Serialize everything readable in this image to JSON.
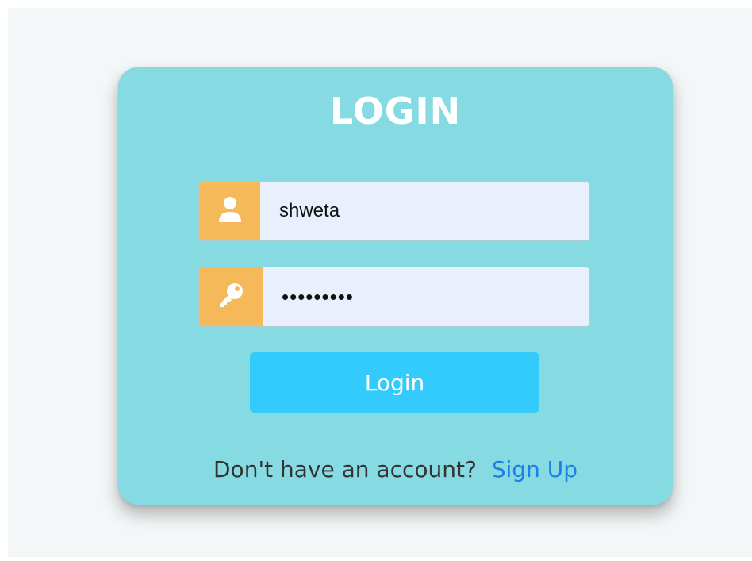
{
  "login_card": {
    "title": "LOGIN",
    "username_field": {
      "value": "shweta",
      "icon": "user-icon"
    },
    "password_field": {
      "value": "•••••••••",
      "icon": "key-icon"
    },
    "login_button_label": "Login",
    "footer": {
      "prompt": "Don't have an account?",
      "signup_link": "Sign Up"
    }
  },
  "colors": {
    "card_background": "#86dbe2",
    "icon_addon": "#f5b95a",
    "input_background": "#e9effc",
    "button": "#33cbfb",
    "link": "#1d7fe8"
  }
}
